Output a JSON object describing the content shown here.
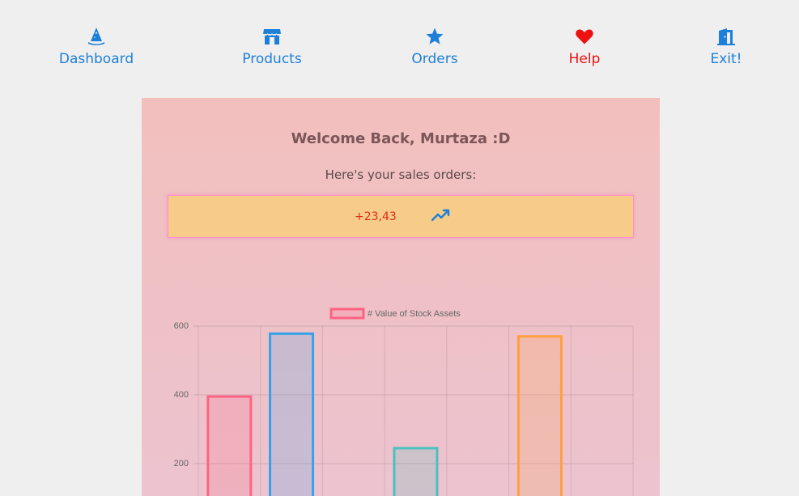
{
  "nav": {
    "items": [
      {
        "label": "Dashboard",
        "icon": "wizard-hat-icon",
        "color": "#1e7fd8"
      },
      {
        "label": "Products",
        "icon": "store-icon",
        "color": "#1e7fd8"
      },
      {
        "label": "Orders",
        "icon": "star-icon",
        "color": "#1e7fd8"
      },
      {
        "label": "Help",
        "icon": "heart-icon",
        "color": "#ee1111"
      },
      {
        "label": "Exit!",
        "icon": "door-exit-icon",
        "color": "#1e7fd8"
      }
    ]
  },
  "main": {
    "welcome": "Welcome Back, Murtaza :D",
    "subtitle": "Here's your sales orders:",
    "sales_value": "+23,43",
    "trend_icon": "trending-up-icon"
  },
  "chart_data": {
    "type": "bar",
    "legend": "# Value of Stock Assets",
    "legend_position": "top",
    "ylim": [
      0,
      600
    ],
    "yticks": [
      200,
      400,
      600
    ],
    "grid": true,
    "values": [
      395,
      578,
      null,
      245,
      null,
      570,
      null
    ],
    "series_colors": [
      {
        "stroke": "#ff6384",
        "fill": "rgba(255,99,132,0.2)"
      },
      {
        "stroke": "#36a2eb",
        "fill": "rgba(54,162,235,0.2)"
      },
      {
        "stroke": "#ffce56",
        "fill": "rgba(255,206,86,0.2)"
      },
      {
        "stroke": "#4bc0c0",
        "fill": "rgba(75,192,192,0.2)"
      },
      {
        "stroke": "#9966ff",
        "fill": "rgba(153,102,255,0.2)"
      },
      {
        "stroke": "#ff9f40",
        "fill": "rgba(255,159,64,0.2)"
      },
      {
        "stroke": "#ff6384",
        "fill": "rgba(255,99,132,0.2)"
      }
    ]
  }
}
